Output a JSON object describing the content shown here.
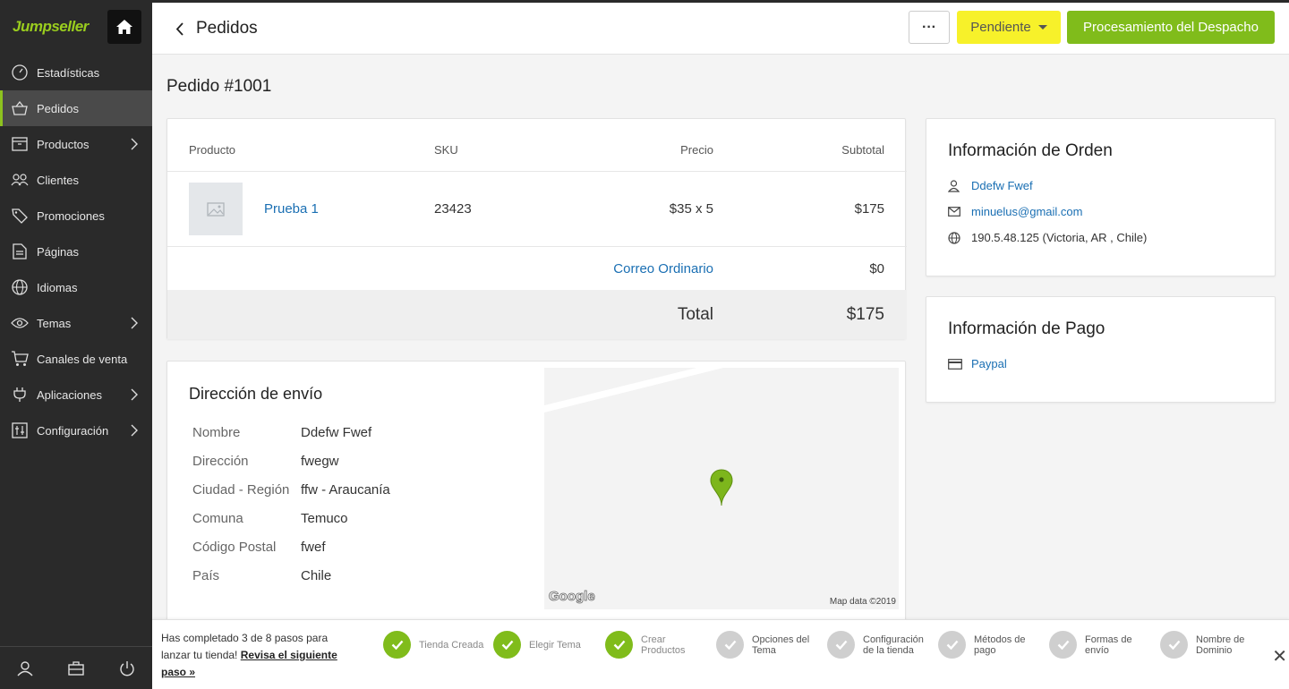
{
  "brand": {
    "logo_first": "Ju",
    "logo_rest": "mpseller",
    "accent": "#80bc1b",
    "status_color": "#f7f12a"
  },
  "sidebar": {
    "items": [
      {
        "label": "Estadísticas",
        "icon": "gauge-icon"
      },
      {
        "label": "Pedidos",
        "icon": "basket-icon",
        "active": true
      },
      {
        "label": "Productos",
        "icon": "box-icon",
        "submenu": true
      },
      {
        "label": "Clientes",
        "icon": "users-icon"
      },
      {
        "label": "Promociones",
        "icon": "tag-icon"
      },
      {
        "label": "Páginas",
        "icon": "page-icon"
      },
      {
        "label": "Idiomas",
        "icon": "globe-icon"
      },
      {
        "label": "Temas",
        "icon": "eye-icon",
        "submenu": true
      },
      {
        "label": "Canales de venta",
        "icon": "cart-icon"
      },
      {
        "label": "Aplicaciones",
        "icon": "plug-icon",
        "submenu": true
      },
      {
        "label": "Configuración",
        "icon": "sliders-icon",
        "submenu": true
      }
    ]
  },
  "header": {
    "title": "Pedidos",
    "more_label": "···",
    "status_label": "Pendiente",
    "primary_label": "Procesamiento del Despacho"
  },
  "order": {
    "title": "Pedido #1001",
    "columns": {
      "product": "Producto",
      "sku": "SKU",
      "price": "Precio",
      "subtotal": "Subtotal"
    },
    "item": {
      "name": "Prueba 1",
      "sku": "23423",
      "price": "$35 x 5",
      "subtotal": "$175"
    },
    "shipping": {
      "name": "Correo Ordinario",
      "cost": "$0"
    },
    "total": {
      "label": "Total",
      "value": "$175"
    }
  },
  "address": {
    "title": "Dirección de envío",
    "rows": [
      {
        "label": "Nombre",
        "value": "Ddefw Fwef"
      },
      {
        "label": "Dirección",
        "value": "fwegw"
      },
      {
        "label": "Ciudad - Región",
        "value": "ffw - Araucanía"
      },
      {
        "label": "Comuna",
        "value": "Temuco"
      },
      {
        "label": "Código Postal",
        "value": "fwef"
      },
      {
        "label": "País",
        "value": "Chile"
      }
    ],
    "map": {
      "logo": "Google",
      "attribution": "Map data ©2019"
    }
  },
  "order_info": {
    "title": "Información de Orden",
    "customer": "Ddefw Fwef",
    "email": "minuelus@gmail.com",
    "ip": "190.5.48.125 (Victoria, AR , Chile)"
  },
  "payment_info": {
    "title": "Información de Pago",
    "method": "Paypal"
  },
  "onboarding": {
    "text": "Has completado 3 de 8 pasos para lanzar tu tienda!",
    "link": "Revisa el siguiente paso »",
    "steps": [
      {
        "label": "Tienda Creada",
        "done": true
      },
      {
        "label": "Elegir Tema",
        "done": true
      },
      {
        "label": "Crear Productos",
        "done": true
      },
      {
        "label": "Opciones del Tema",
        "done": false
      },
      {
        "label": "Configuración de la tienda",
        "done": false
      },
      {
        "label": "Métodos de pago",
        "done": false
      },
      {
        "label": "Formas de envío",
        "done": false
      },
      {
        "label": "Nombre de Dominio",
        "done": false
      }
    ],
    "close": "✕"
  }
}
